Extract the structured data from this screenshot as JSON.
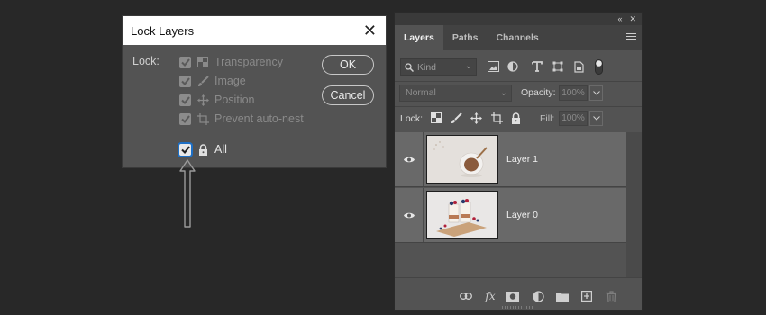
{
  "dialog": {
    "title": "Lock Layers",
    "lock_label": "Lock:",
    "options": [
      "Transparency",
      "Image",
      "Position",
      "Prevent auto-nest"
    ],
    "all_label": "All",
    "ok_label": "OK",
    "cancel_label": "Cancel"
  },
  "panel": {
    "tabs": [
      "Layers",
      "Paths",
      "Channels"
    ],
    "kind_placeholder": "Kind",
    "blend_mode": "Normal",
    "opacity_label": "Opacity:",
    "opacity_value": "100%",
    "lock_label": "Lock:",
    "fill_label": "Fill:",
    "fill_value": "100%",
    "layers": [
      {
        "name": "Layer 1",
        "visible": true
      },
      {
        "name": "Layer 0",
        "visible": true
      }
    ]
  },
  "colors": {
    "background": "#282828",
    "panel": "#535353",
    "layer_row": "#696969",
    "focus_ring": "#1d6fc5"
  }
}
